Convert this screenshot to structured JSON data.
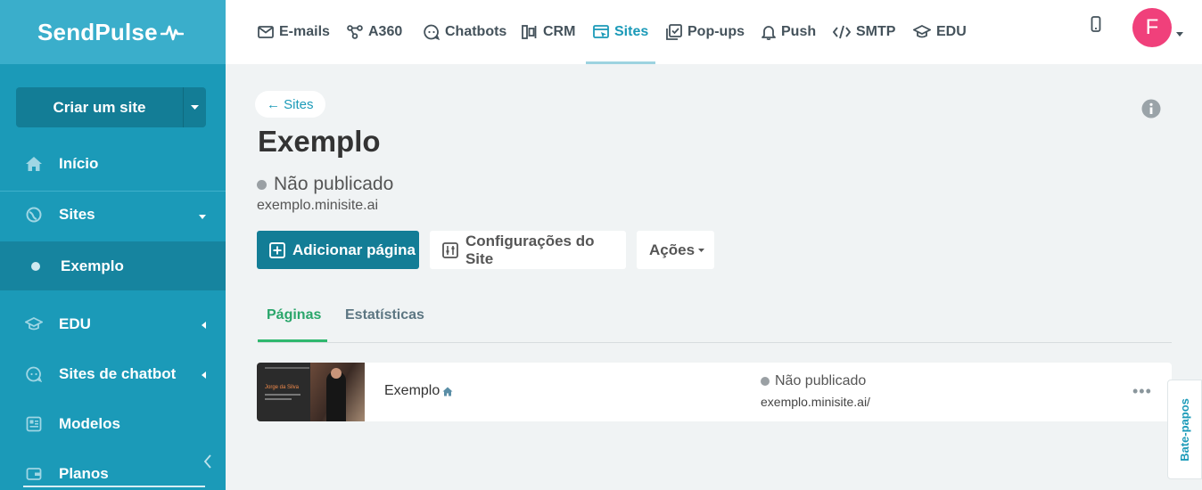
{
  "brand": {
    "logo_text": "SendPulse"
  },
  "sidebar": {
    "create_button": "Criar um site",
    "items": [
      {
        "label": "Início",
        "icon": "home-icon"
      },
      {
        "label": "Sites",
        "icon": "globe-icon"
      },
      {
        "label": "Exemplo",
        "icon": "dot"
      },
      {
        "label": "EDU",
        "icon": "graduation-cap-icon"
      },
      {
        "label": "Sites de chatbot",
        "icon": "chatbot-icon"
      },
      {
        "label": "Modelos",
        "icon": "templates-icon"
      },
      {
        "label": "Planos",
        "icon": "wallet-icon"
      }
    ]
  },
  "topnav": {
    "tabs": [
      {
        "label": "E-mails",
        "icon": "mail-icon"
      },
      {
        "label": "A360",
        "icon": "automation-icon"
      },
      {
        "label": "Chatbots",
        "icon": "chat-icon"
      },
      {
        "label": "CRM",
        "icon": "crm-icon"
      },
      {
        "label": "Sites",
        "icon": "sites-icon",
        "active": true
      },
      {
        "label": "Pop-ups",
        "icon": "popup-icon"
      },
      {
        "label": "Push",
        "icon": "bell-icon"
      },
      {
        "label": "SMTP",
        "icon": "code-icon"
      },
      {
        "label": "EDU",
        "icon": "graduation-cap-icon"
      }
    ],
    "avatar_initial": "F"
  },
  "main": {
    "back_link": "← Sites",
    "title": "Exemplo",
    "status": "Não publicado",
    "domain": "exemplo.minisite.ai",
    "buttons": {
      "add_page": "Adicionar página",
      "site_settings": "Configurações do Site",
      "actions": "Ações"
    },
    "tabs": [
      {
        "label": "Páginas",
        "active": true
      },
      {
        "label": "Estatísticas",
        "active": false
      }
    ],
    "pages": [
      {
        "name": "Exemplo",
        "status": "Não publicado",
        "url": "exemplo.minisite.ai/",
        "thumbnail_text": "Jorge da Silva"
      }
    ]
  },
  "chat_widget": {
    "label": "Bate-papos"
  },
  "colors": {
    "sidebar": "#1b9ab8",
    "logo_bar": "#3aaecb",
    "primary_button": "#137d96",
    "accent_green": "#2fb86e",
    "avatar": "#f0407b"
  }
}
